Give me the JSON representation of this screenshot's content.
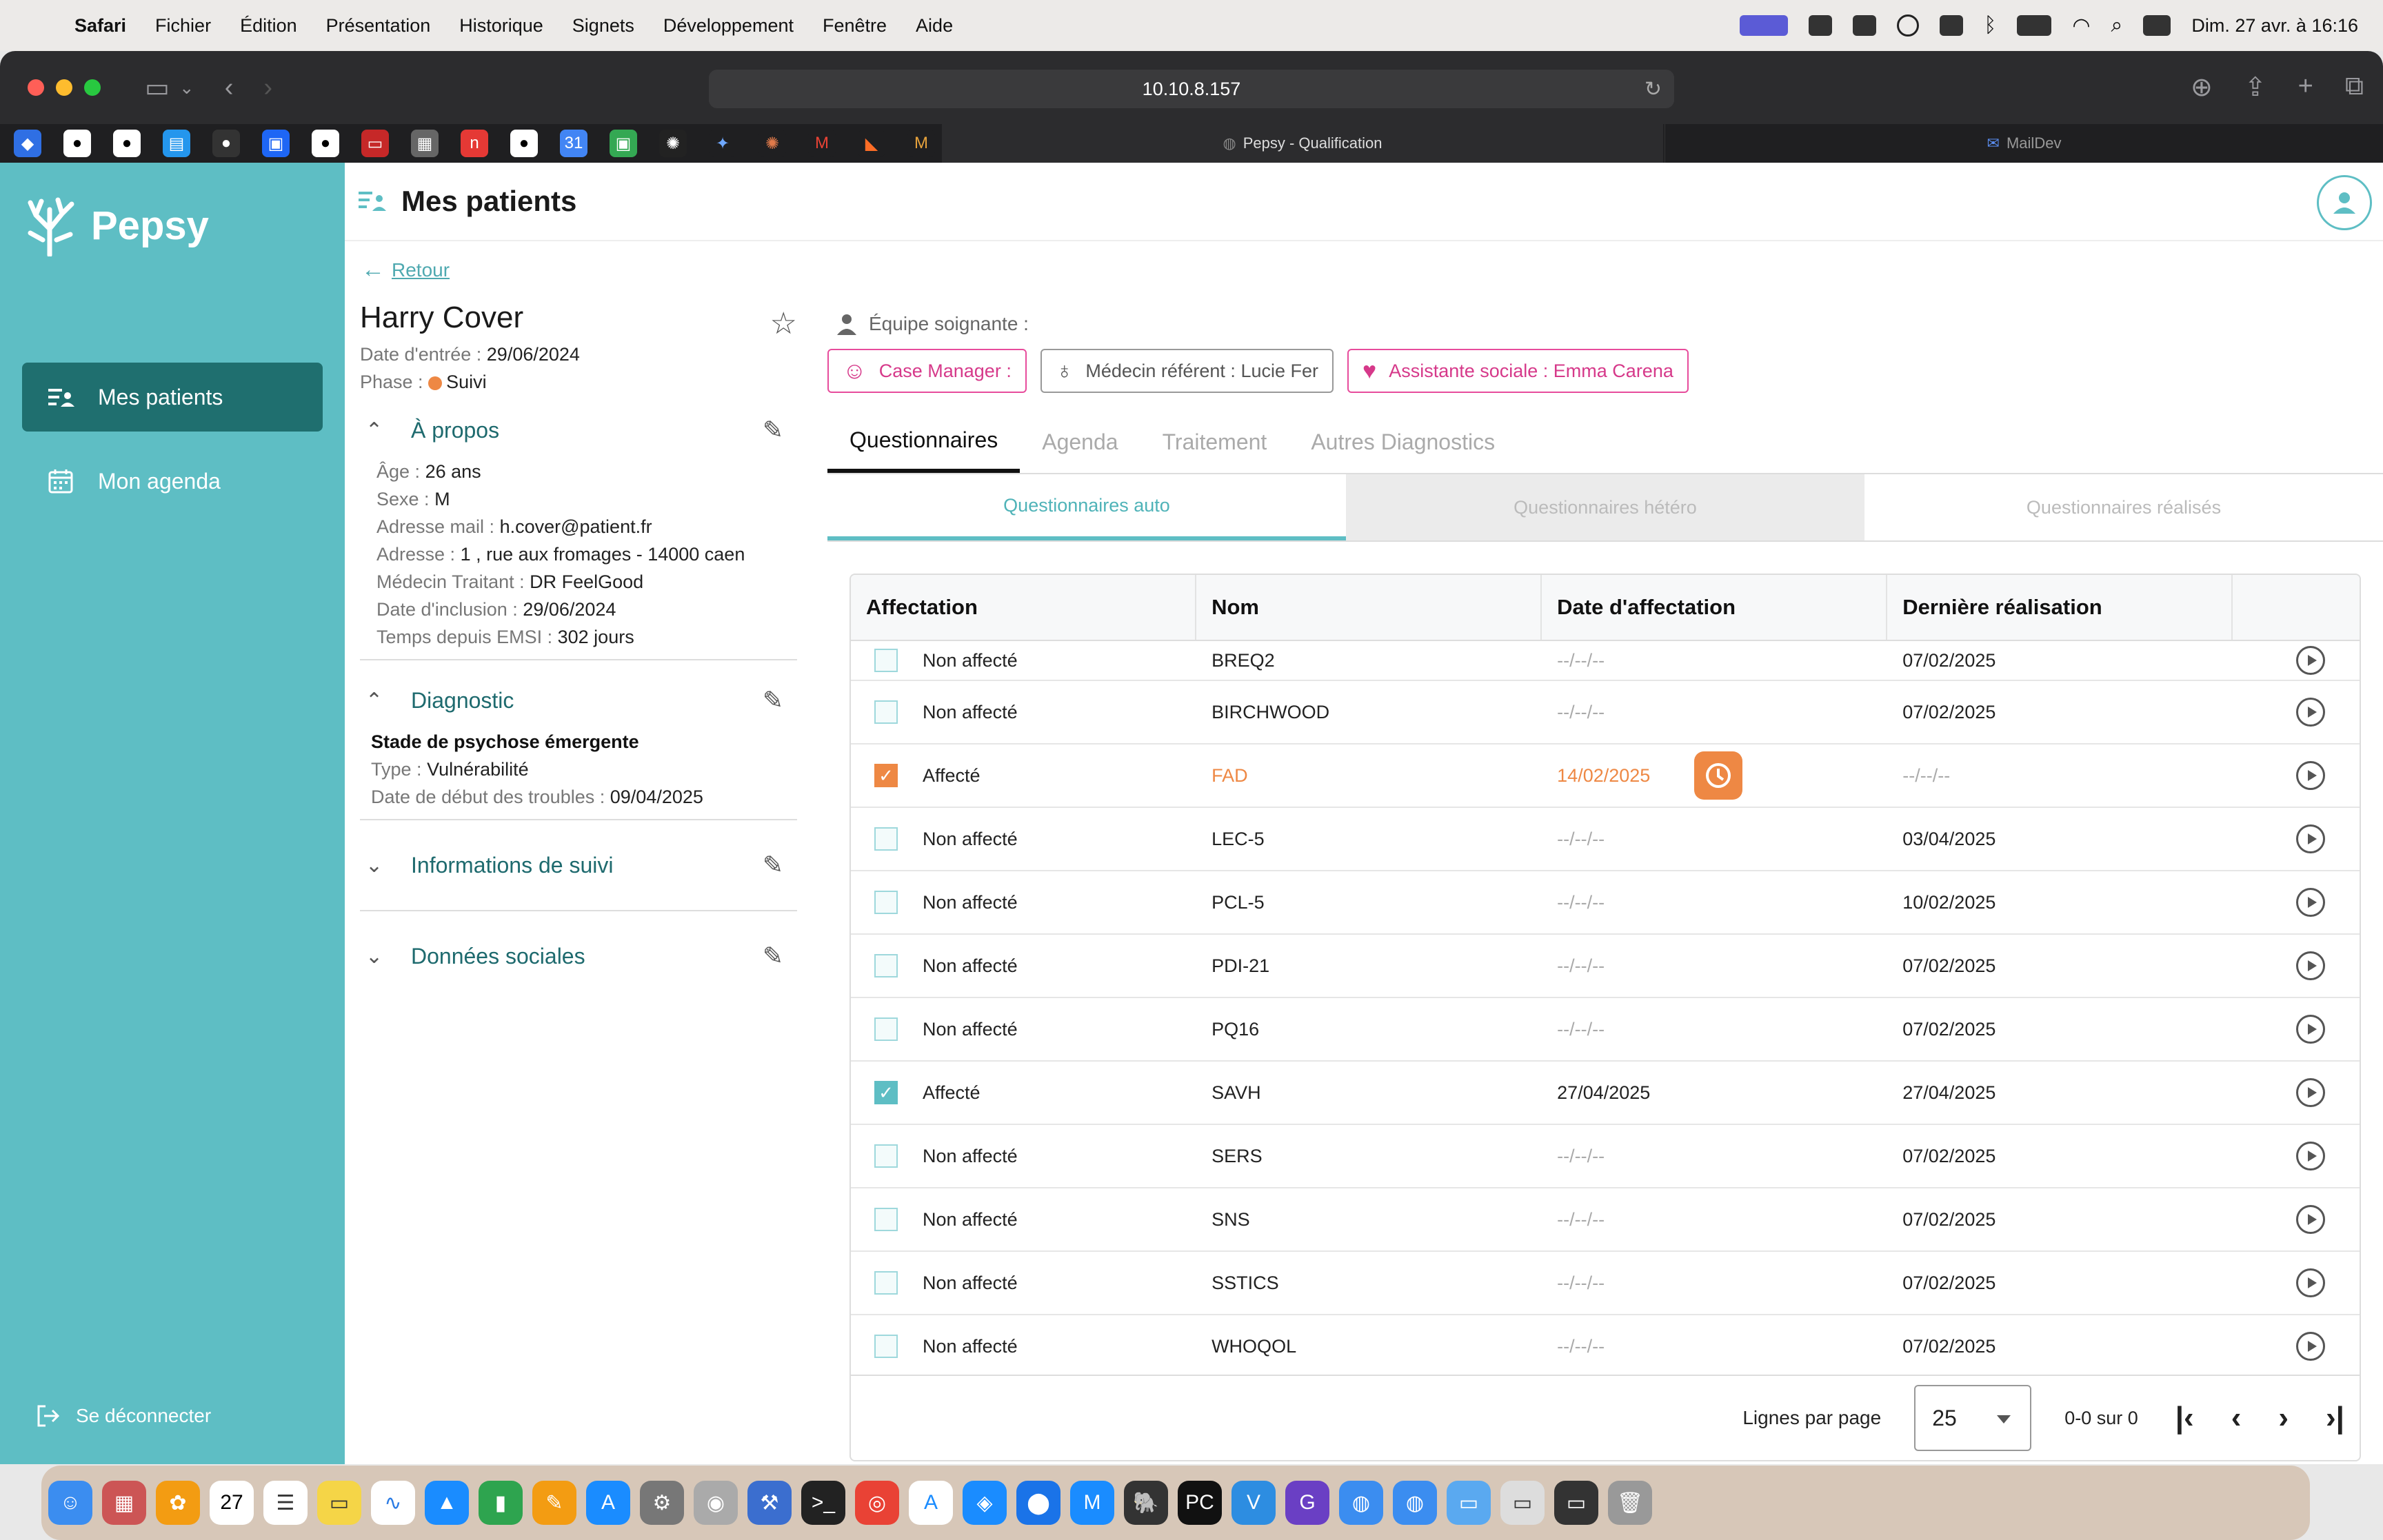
{
  "menubar": {
    "items": [
      "Safari",
      "Fichier",
      "Édition",
      "Présentation",
      "Historique",
      "Signets",
      "Développement",
      "Fenêtre",
      "Aide"
    ],
    "datetime": "Dim. 27 avr. à 16:16"
  },
  "browser": {
    "url": "10.10.8.157",
    "active_tab": "Pepsy - Qualification",
    "other_tab": "MailDev"
  },
  "sidebar": {
    "brand": "Pepsy",
    "items": [
      {
        "label": "Mes patients",
        "icon": "patients-list-icon"
      },
      {
        "label": "Mon agenda",
        "icon": "calendar-icon"
      }
    ],
    "logout": "Se déconnecter"
  },
  "header": {
    "title": "Mes patients"
  },
  "back_label": "Retour",
  "patient": {
    "name": "Harry Cover",
    "entry_label": "Date d'entrée :",
    "entry_date": "29/06/2024",
    "phase_label": "Phase :",
    "phase_value": "Suivi",
    "phase_color": "#ee8844"
  },
  "about": {
    "title": "À propos",
    "fields": [
      {
        "label": "Âge :",
        "value": "26 ans"
      },
      {
        "label": "Sexe :",
        "value": "M"
      },
      {
        "label": "Adresse mail :",
        "value": "h.cover@patient.fr"
      },
      {
        "label": "Adresse :",
        "value": "1 , rue aux fromages - 14000 caen"
      },
      {
        "label": "Médecin Traitant :",
        "value": "DR FeelGood"
      },
      {
        "label": "Date d'inclusion :",
        "value": "29/06/2024"
      },
      {
        "label": "Temps depuis EMSI :",
        "value": "302 jours"
      }
    ]
  },
  "diagnostic": {
    "title": "Diagnostic",
    "stage": "Stade de psychose émergente",
    "type_label": "Type :",
    "type_value": "Vulnérabilité",
    "start_label": "Date de début des troubles :",
    "start_value": "09/04/2025"
  },
  "followup": {
    "title": "Informations de suivi"
  },
  "social": {
    "title": "Données sociales"
  },
  "team": {
    "label": "Équipe soignante :",
    "chips": [
      {
        "label": "Case Manager :",
        "style": "pink"
      },
      {
        "label": "Médecin référent : Lucie Fer",
        "style": "grey"
      },
      {
        "label": "Assistante sociale : Emma Carena",
        "style": "pink"
      }
    ]
  },
  "tabs": [
    "Questionnaires",
    "Agenda",
    "Traitement",
    "Autres Diagnostics"
  ],
  "subtabs": [
    "Questionnaires auto",
    "Questionnaires hétéro",
    "Questionnaires réalisés"
  ],
  "table": {
    "headers": [
      "Affectation",
      "Nom",
      "Date d'affectation",
      "Dernière réalisation",
      ""
    ],
    "rows": [
      {
        "status": "Non affecté",
        "name": "BREQ2",
        "assigned": "--/--/--",
        "last": "07/02/2025",
        "state": "none"
      },
      {
        "status": "Non affecté",
        "name": "BIRCHWOOD",
        "assigned": "--/--/--",
        "last": "07/02/2025",
        "state": "none"
      },
      {
        "status": "Affecté",
        "name": "FAD",
        "assigned": "14/02/2025",
        "last": "--/--/--",
        "state": "overdue"
      },
      {
        "status": "Non affecté",
        "name": "LEC-5",
        "assigned": "--/--/--",
        "last": "03/04/2025",
        "state": "none"
      },
      {
        "status": "Non affecté",
        "name": "PCL-5",
        "assigned": "--/--/--",
        "last": "10/02/2025",
        "state": "none"
      },
      {
        "status": "Non affecté",
        "name": "PDI-21",
        "assigned": "--/--/--",
        "last": "07/02/2025",
        "state": "none"
      },
      {
        "status": "Non affecté",
        "name": "PQ16",
        "assigned": "--/--/--",
        "last": "07/02/2025",
        "state": "none"
      },
      {
        "status": "Affecté",
        "name": "SAVH",
        "assigned": "27/04/2025",
        "last": "27/04/2025",
        "state": "assigned"
      },
      {
        "status": "Non affecté",
        "name": "SERS",
        "assigned": "--/--/--",
        "last": "07/02/2025",
        "state": "none"
      },
      {
        "status": "Non affecté",
        "name": "SNS",
        "assigned": "--/--/--",
        "last": "07/02/2025",
        "state": "none"
      },
      {
        "status": "Non affecté",
        "name": "SSTICS",
        "assigned": "--/--/--",
        "last": "07/02/2025",
        "state": "none"
      },
      {
        "status": "Non affecté",
        "name": "WHOQOL",
        "assigned": "--/--/--",
        "last": "07/02/2025",
        "state": "none"
      }
    ]
  },
  "pagination": {
    "rows_label": "Lignes par page",
    "rows_value": "25",
    "range": "0-0 sur 0"
  },
  "colors": {
    "teal": "#5ebec4",
    "teal_dark": "#1f6f6f",
    "orange": "#ee8844",
    "pink": "#e74c9c"
  }
}
